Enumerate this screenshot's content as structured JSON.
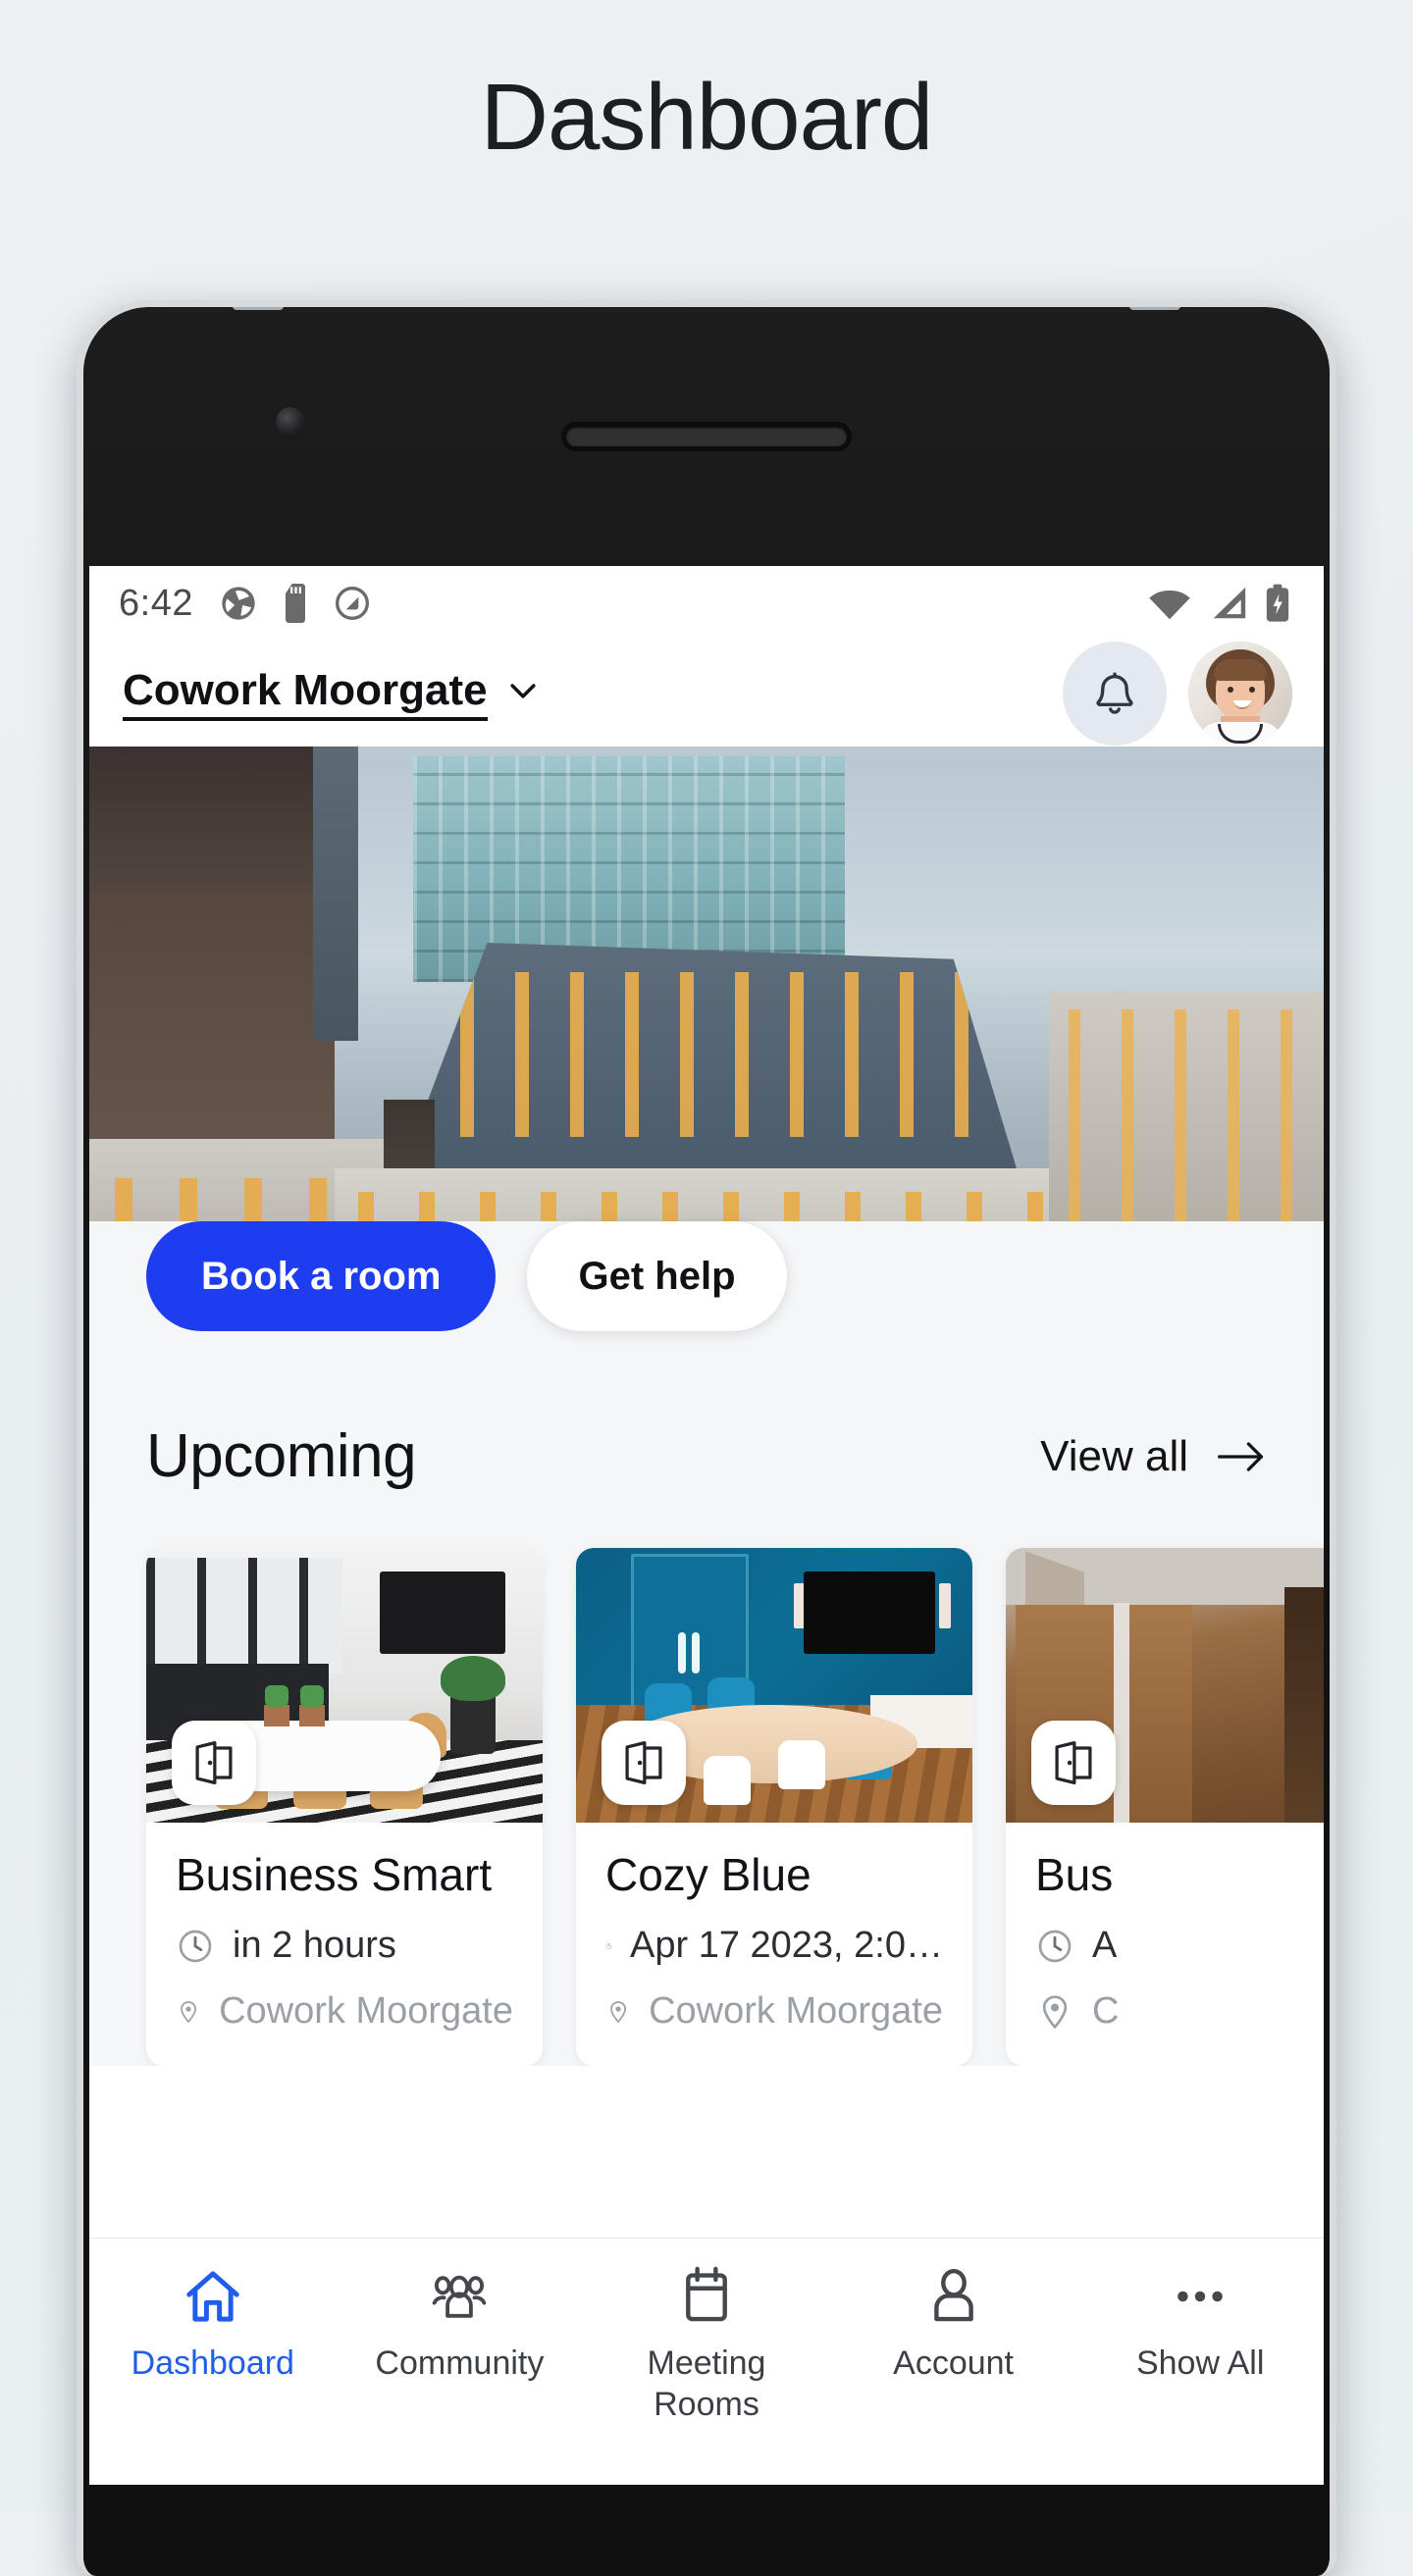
{
  "page": {
    "title": "Dashboard"
  },
  "status_bar": {
    "time": "6:42",
    "left_icons": [
      "camera-shutter-icon",
      "sd-card-icon",
      "do-not-disturb-icon"
    ],
    "right_icons": [
      "wifi-icon",
      "cellular-signal-icon",
      "battery-charging-icon"
    ]
  },
  "app_header": {
    "location_name": "Cowork Moorgate",
    "location_chevron": "chevron-down-icon",
    "notifications_icon": "bell-icon",
    "avatar": "user-avatar"
  },
  "hero": {
    "alt": "city-office-buildings-photo",
    "primary_button": "Book a room",
    "secondary_button": "Get help"
  },
  "upcoming": {
    "title": "Upcoming",
    "view_all_label": "View all",
    "view_all_icon": "arrow-right-icon",
    "cards": [
      {
        "badge_icon": "open-door-icon",
        "title": "Business Smart",
        "time_icon": "clock-icon",
        "time": "in 2 hours",
        "location_icon": "map-pin-icon",
        "location": "Cowork Moorgate"
      },
      {
        "badge_icon": "open-door-icon",
        "title": "Cozy Blue",
        "time_icon": "clock-icon",
        "time": "Apr 17 2023, 2:0…",
        "location_icon": "map-pin-icon",
        "location": "Cowork Moorgate"
      },
      {
        "badge_icon": "open-door-icon",
        "title": "Bus",
        "time_icon": "clock-icon",
        "time": "A",
        "location_icon": "map-pin-icon",
        "location": "C"
      }
    ]
  },
  "bottom_nav": {
    "active_color": "#1f5dea",
    "items": [
      {
        "label": "Dashboard",
        "icon": "home-icon",
        "active": true
      },
      {
        "label": "Community",
        "icon": "people-icon",
        "active": false
      },
      {
        "label": "Meeting\nRooms",
        "icon": "calendar-icon",
        "active": false
      },
      {
        "label": "Account",
        "icon": "person-icon",
        "active": false
      },
      {
        "label": "Show All",
        "icon": "ellipsis-icon",
        "active": false
      }
    ]
  },
  "colors": {
    "primary_blue": "#1f3df0",
    "nav_active_blue": "#1f5dea",
    "page_background": "#eef1f4",
    "section_background": "#f5f6f8"
  }
}
